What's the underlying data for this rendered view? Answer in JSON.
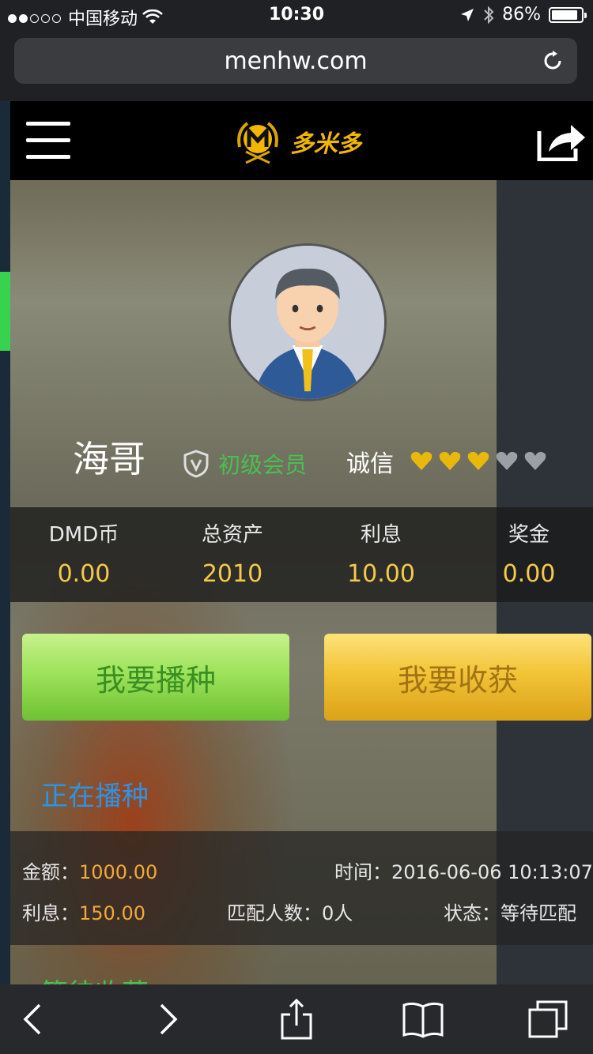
{
  "status_bar": {
    "carrier": "中国移动",
    "time": "10:30",
    "battery": "86%",
    "battery_level": 0.86,
    "signal_dots_filled": 2,
    "signal_dots_total": 5,
    "icons": [
      "wifi-icon",
      "location-arrow-icon",
      "bluetooth-icon",
      "battery-icon"
    ]
  },
  "browser": {
    "url": "menhw.com",
    "toolbar_icons": [
      "back-icon",
      "forward-icon",
      "share-icon",
      "bookmarks-icon",
      "tabs-icon"
    ]
  },
  "header": {
    "logo_text": "多米多",
    "icons": [
      "menu-icon",
      "logo-emblem-icon",
      "share-external-icon"
    ]
  },
  "profile": {
    "name": "海哥",
    "member_level": "初级会员",
    "credit_label": "诚信",
    "hearts_filled": 3,
    "hearts_total": 5
  },
  "stats": [
    {
      "label": "DMD币",
      "value": "0.00"
    },
    {
      "label": "总资产",
      "value": "2010"
    },
    {
      "label": "利息",
      "value": "10.00"
    },
    {
      "label": "奖金",
      "value": "0.00"
    }
  ],
  "actions": {
    "sow_label": "我要播种",
    "harvest_label": "我要收获"
  },
  "sowing": {
    "title": "正在播种",
    "amount_label": "金额：",
    "amount_value": "1000.00",
    "time_label": "时间：",
    "time_value": "2016-06-06 10:13:07",
    "interest_label": "利息：",
    "interest_value": "150.00",
    "match_label": "匹配人数：",
    "match_value": "0人",
    "status_label": "状态：",
    "status_value": "等待匹配"
  },
  "waiting": {
    "title": "等待收获"
  },
  "colors": {
    "accent_gold": "#f6c94a",
    "member_green": "#49c04f",
    "link_blue": "#2d93e3",
    "amount_orange": "#f3a93a",
    "heart_gold": "#e8b90c",
    "heart_gray": "#9aa0a6"
  }
}
